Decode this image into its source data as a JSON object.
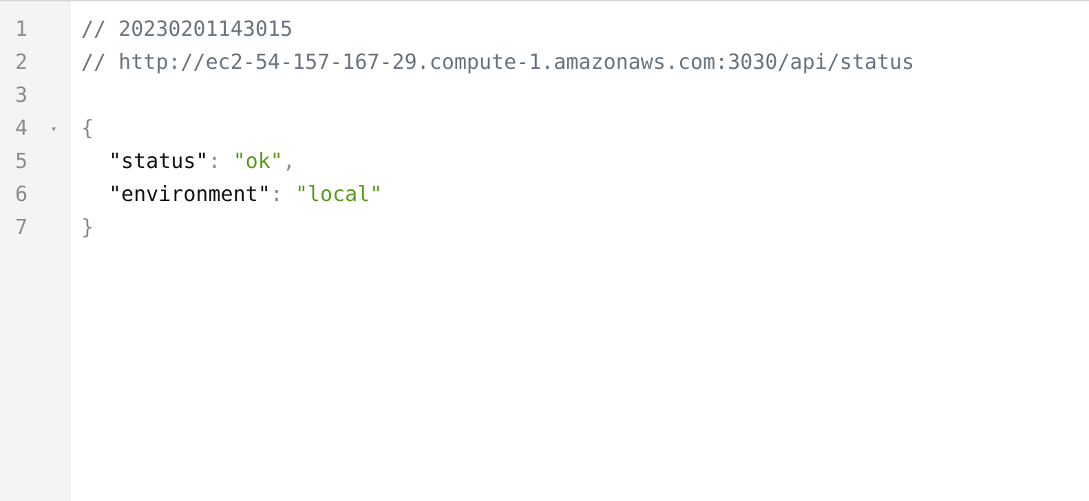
{
  "colors": {
    "comment": "#6a737d",
    "key": "#111111",
    "string": "#5c9a1f",
    "punctuation": "#8a8a8a",
    "line_number": "#8c8c8c",
    "gutter_background": "#f4f4f4"
  },
  "fold_icon": "triangle-down-icon",
  "fold_glyph": "▾",
  "lines": [
    {
      "number": "1",
      "comment": "// 20230201143015"
    },
    {
      "number": "2",
      "comment": "// http://ec2-54-157-167-29.compute-1.amazonaws.com:3030/api/status"
    },
    {
      "number": "3"
    },
    {
      "number": "4",
      "open_brace": "{"
    },
    {
      "number": "5",
      "key": "\"status\"",
      "colon": ": ",
      "value": "\"ok\"",
      "comma": ","
    },
    {
      "number": "6",
      "key": "\"environment\"",
      "colon": ": ",
      "value": "\"local\""
    },
    {
      "number": "7",
      "close_brace": "}"
    }
  ]
}
